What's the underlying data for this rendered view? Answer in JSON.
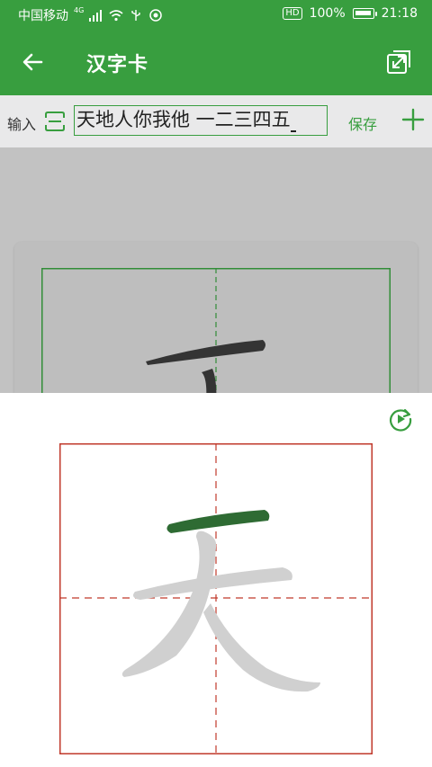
{
  "status_bar": {
    "carrier": "中国移动",
    "network": "4G",
    "hd": "HD",
    "battery": "100%",
    "battery_level": 1.0,
    "time": "21:18"
  },
  "app_bar": {
    "title": "汉字卡",
    "back_icon": "arrow-left-icon",
    "expand_icon": "expand-icon"
  },
  "input_row": {
    "label": "输入",
    "text_value": "天地人你我他 一二三四五",
    "save_label": "保存",
    "scan_icon": "scan-icon",
    "add_icon": "plus-icon"
  },
  "preview": {
    "character_shown": "天",
    "stroke_index": 1
  },
  "colors": {
    "primary": "#389e3f",
    "grid_red": "#c0392b",
    "active_stroke": "#2e6b33",
    "inactive_stroke": "#d0d0d0"
  }
}
